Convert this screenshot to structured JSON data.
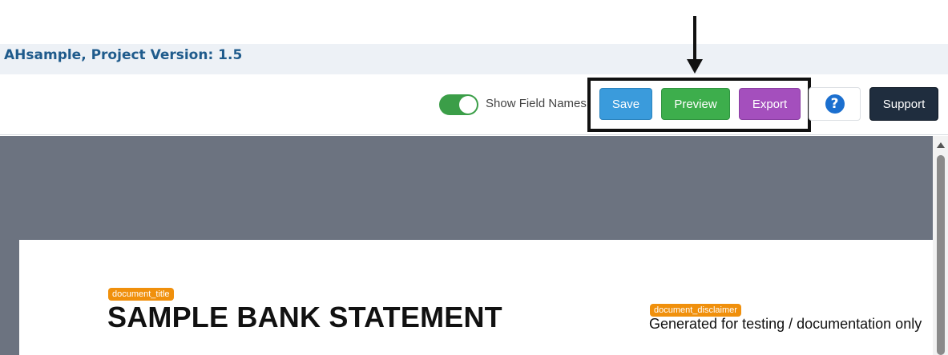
{
  "project": {
    "title": "AHsample, Project Version: 1.5"
  },
  "toolbar": {
    "toggle_label": "Show Field Names",
    "toggle_on": true,
    "save_label": "Save",
    "preview_label": "Preview",
    "export_label": "Export",
    "help_symbol": "?",
    "support_label": "Support"
  },
  "document": {
    "title_tag": "document_title",
    "title": "SAMPLE BANK STATEMENT",
    "disclaimer_tag": "document_disclaimer",
    "disclaimer": "Generated for testing / documentation only"
  },
  "colors": {
    "accent": "#1f5b8c",
    "save": "#3a9bdc",
    "preview": "#3dae4c",
    "export": "#a44fbd",
    "support": "#1f2d3e",
    "field_tag": "#f0900c",
    "canvas": "#6c7380"
  },
  "icons": {
    "help": "question-circle-icon",
    "arrow": "down-arrow-icon"
  }
}
